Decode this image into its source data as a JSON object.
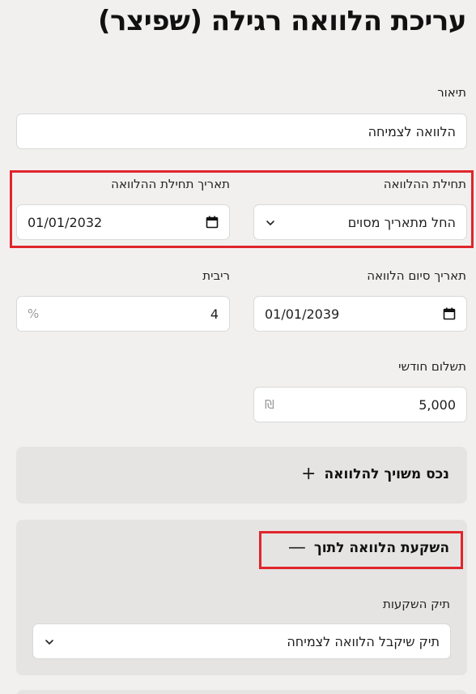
{
  "page": {
    "title": "עריכת הלוואה רגילה (שפיצר)"
  },
  "form": {
    "description": {
      "label": "תיאור",
      "value": "הלוואה לצמיחה"
    },
    "loan_start": {
      "label": "תחילת ההלוואה",
      "value": "החל מתאריך מסוים"
    },
    "loan_start_date": {
      "label": "תאריך תחילת ההלוואה",
      "value": "01/01/2032"
    },
    "loan_end_date": {
      "label": "תאריך סיום הלוואה",
      "value": "01/01/2039"
    },
    "interest": {
      "label": "ריבית",
      "value": "4",
      "suffix": "%"
    },
    "monthly_payment": {
      "label": "תשלום חודשי",
      "value": "5,000",
      "suffix": "₪"
    }
  },
  "sections": {
    "linked_asset": {
      "title": "נכס משויך להלוואה",
      "toggle": "+"
    },
    "invest_into": {
      "title": "השקעת הלוואה לתוך",
      "toggle": "—",
      "portfolio_label": "תיק השקעות",
      "portfolio_value": "תיק שיקבל הלוואה לצמיחה"
    }
  },
  "icons": {
    "calendar": "calendar-icon",
    "dropdown": "chevron-down-icon"
  },
  "colors": {
    "highlight": "#e0252b",
    "background": "#f1f0ef",
    "card": "#e5e4e3"
  }
}
